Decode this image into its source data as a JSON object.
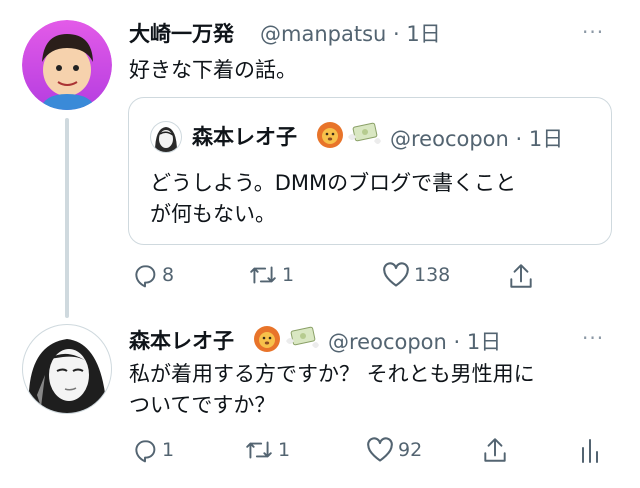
{
  "tweet1": {
    "author_name": "大崎一万発",
    "handle": "@manpatsu",
    "time": "1日",
    "text": "好きな下着の話。",
    "quote": {
      "author_name": "森本レオ子",
      "handle": "@reocopon",
      "time": "1日",
      "text_line1": "どうしよう。DMMのブログで書くこと",
      "text_line2": "が何もない。"
    },
    "stats": {
      "replies": "8",
      "retweets": "1",
      "likes": "138"
    }
  },
  "tweet2": {
    "author_name": "森本レオ子",
    "handle": "@reocopon",
    "time": "1日",
    "text_line1": "私が着用する方ですか？ それとも男性用に",
    "text_line2": "ついてですか？",
    "stats": {
      "replies": "1",
      "retweets": "1",
      "likes": "92"
    }
  },
  "ui": {
    "separator": "·",
    "more": "···"
  },
  "icons": [
    "reply-icon",
    "retweet-icon",
    "like-icon",
    "share-icon",
    "analytics-icon",
    "lion-emoji-icon",
    "money-emoji-icon"
  ],
  "colors": {
    "secondary_text": "#536471",
    "border": "#cfd9de",
    "avatar1_ring": "#d44cf0"
  }
}
